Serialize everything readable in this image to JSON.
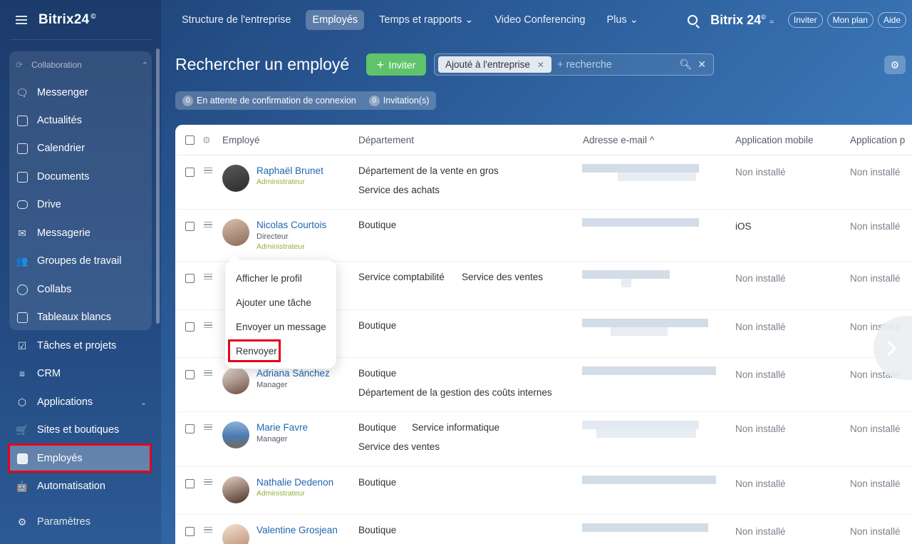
{
  "sidebar": {
    "brand": "Bitrix24",
    "brand_mark": "©",
    "group_label": "Collaboration",
    "items": [
      {
        "label": "Messenger"
      },
      {
        "label": "Actualités"
      },
      {
        "label": "Calendrier"
      },
      {
        "label": "Documents"
      },
      {
        "label": "Drive"
      },
      {
        "label": "Messagerie"
      },
      {
        "label": "Groupes de travail"
      },
      {
        "label": "Collabs"
      },
      {
        "label": "Tableaux blancs"
      },
      {
        "label": "Tâches et projets"
      },
      {
        "label": "CRM"
      },
      {
        "label": "Applications"
      },
      {
        "label": "Sites et boutiques"
      },
      {
        "label": "Employés"
      },
      {
        "label": "Automatisation"
      },
      {
        "label": "Paramètres"
      }
    ]
  },
  "topnav": {
    "tabs": [
      {
        "label": "Structure de l'entreprise"
      },
      {
        "label": "Employés"
      },
      {
        "label": "Temps et rapports ⌄"
      },
      {
        "label": "Video Conferencing"
      },
      {
        "label": "Plus ⌄"
      }
    ],
    "brand": "Bitrix 24",
    "brand_mark": "©",
    "invite": "Inviter",
    "plan": "Mon plan",
    "help": "Aide"
  },
  "page": {
    "title": "Rechercher un employé",
    "invite_button": "Inviter",
    "filter_tag": "Ajouté à l'entreprise",
    "search_placeholder": "+ recherche",
    "pending_count": "0",
    "pending_label": "En attente de confirmation de connexion",
    "invitations_count": "0",
    "invitations_label": "Invitation(s)"
  },
  "table": {
    "headers": {
      "employee": "Employé",
      "department": "Département",
      "email": "Adresse e-mail ^",
      "mobile": "Application mobile",
      "desktop": "Application p"
    },
    "rows": [
      {
        "name": "Raphaël Brunet",
        "position": "",
        "role": "Administrateur",
        "dept1": "Département de la vente en gros",
        "dept2": "Service des achats",
        "mobile": "Non installé",
        "desktop": "Non installé"
      },
      {
        "name": "Nicolas Courtois",
        "position": "Directeur",
        "role": "Administrateur",
        "dept1": "Boutique",
        "dept2": "",
        "mobile": "iOS",
        "desktop": "Non installé"
      },
      {
        "name": "",
        "position": "",
        "role": "",
        "dept1": "Service comptabilité",
        "dept1b": "Service des ventes",
        "mobile": "Non installé",
        "desktop": "Non installé"
      },
      {
        "name": "",
        "position": "",
        "role": "",
        "dept1": "Boutique",
        "dept2": "",
        "mobile": "Non installé",
        "desktop": "Non installé"
      },
      {
        "name": "Adriana Sánchez",
        "position": "Manager",
        "role": "",
        "dept1": "Boutique",
        "dept2": "Département de la gestion des coûts internes",
        "mobile": "Non installé",
        "desktop": "Non installé"
      },
      {
        "name": "Marie Favre",
        "position": "Manager",
        "role": "",
        "dept1": "Boutique",
        "dept1b": "Service informatique",
        "dept2": "Service des ventes",
        "mobile": "Non installé",
        "desktop": "Non installé"
      },
      {
        "name": "Nathalie Dedenon",
        "position": "",
        "role": "Administrateur",
        "dept1": "Boutique",
        "dept2": "",
        "mobile": "Non installé",
        "desktop": "Non installé"
      },
      {
        "name": "Valentine Grosjean",
        "position": "",
        "role": "",
        "dept1": "Boutique",
        "dept2": "",
        "mobile": "Non installé",
        "desktop": "Non installé"
      }
    ]
  },
  "context_menu": {
    "items": [
      "Afficher le profil",
      "Ajouter une tâche",
      "Envoyer un message",
      "Renvoyer"
    ]
  },
  "colors": {
    "accent_green": "#5fc36b",
    "link_blue": "#2067b0",
    "admin_green": "#8fb13d",
    "highlight_red": "#e3001b"
  }
}
